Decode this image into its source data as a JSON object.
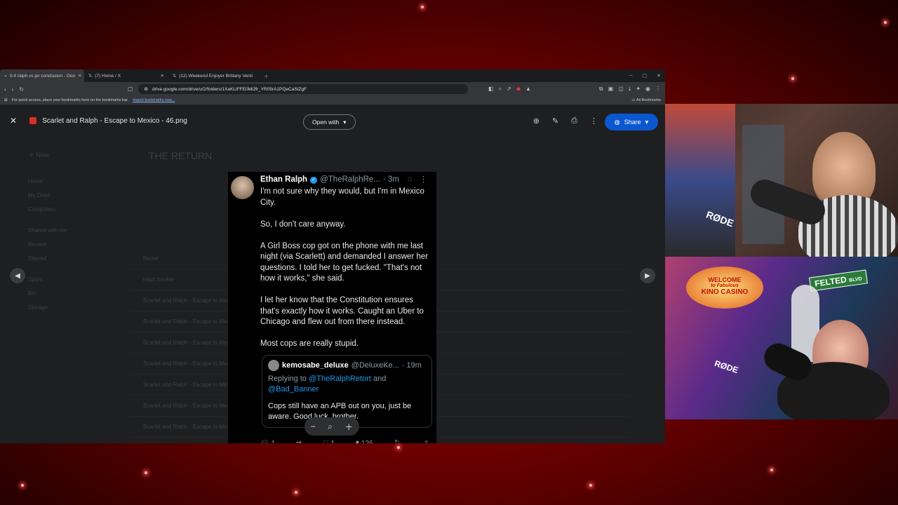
{
  "tabs": [
    {
      "label": "0.4 ralph vs jer conclusion - Goo",
      "active": true
    },
    {
      "label": "(7) Home / X",
      "active": false
    },
    {
      "label": "(12) Weekend Enjoyer Brittany Venti",
      "active": false
    }
  ],
  "address": {
    "url": "drive.google.com/drive/u/2/folders/1XaKLIFFE0Mi2fr_YR05rA1PQeCaStZgF"
  },
  "bookmarks": {
    "prompt": "For quick access, place your bookmarks here on the bookmarks bar.",
    "import_link": "Import bookmarks now...",
    "all_label": "All Bookmarks"
  },
  "viewer": {
    "file_title": "Scarlet and Ralph - Escape to Mexico - 46.png",
    "open_with": "Open with",
    "share": "Share"
  },
  "tweet": {
    "name": "Ethan Ralph",
    "handle": "@TheRalphRe...",
    "time": "· 3m",
    "paragraphs": [
      "I'm not sure why they would, but I'm in Mexico City.",
      "So, I don't care anyway.",
      "A Girl Boss cop got on the phone with me last night (via Scarlett) and demanded I answer her questions. I told her to get fucked. \"That's not how it works,\" she said.",
      "I let her know that the Constitution ensures that's exactly how it works. Caught an Uber to Chicago and flew out from there instead.",
      "Most cops are really stupid."
    ],
    "quote": {
      "name": "kemosabe_deluxe",
      "handle": "@DeluxeKe...",
      "time": "· 19m",
      "replying_prefix": "Replying to",
      "replying_to": "@TheRalphRetort",
      "replying_and": "and",
      "replying_to2": "@Bad_Banner",
      "text": "Cops still have an APB out on you, just be aware. Good luck, brother."
    },
    "actions": {
      "replies": "1",
      "likes": "1",
      "views": "126"
    }
  },
  "cams": {
    "mic_brand": "RØDE",
    "sign_welcome": "WELCOME",
    "sign_fabulous": "to Fabulous",
    "sign_kino": "KINO CASINO",
    "street_sign": "FELTED",
    "street_suffix": "BLVD"
  },
  "colors": {
    "share_blue": "#0b57d0",
    "twitter_blue": "#1d9bf0",
    "bg_red": "#b00000"
  }
}
